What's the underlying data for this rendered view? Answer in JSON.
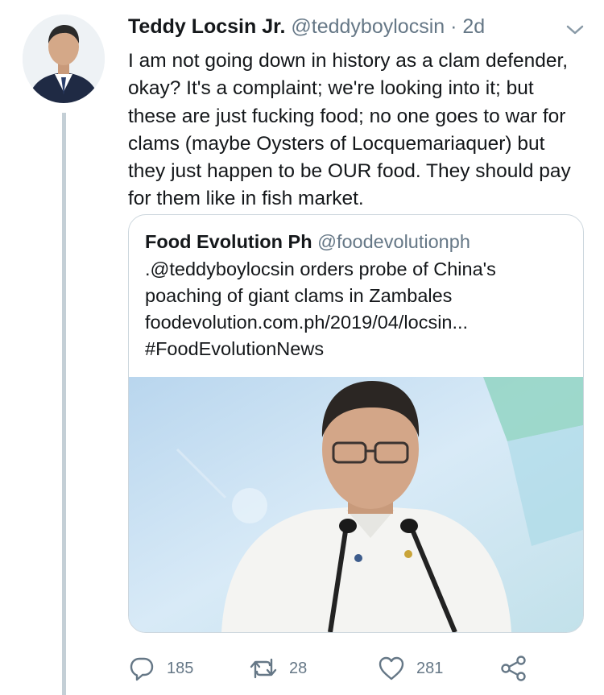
{
  "tweet": {
    "author_name": "Teddy Locsin Jr.",
    "handle": "@teddyboylocsin",
    "separator": "·",
    "time": "2d",
    "text": "I am not going down in history as a clam defender,\nokay? It's a complaint; we're looking into it; but\nthese are just fucking food; no one goes to war for\nclams (maybe Oysters of Locquemariaquer) but\nthey just happen to be OUR food. They should pay\nfor them like in fish market."
  },
  "quoted_tweet": {
    "author_name": "Food Evolution Ph",
    "handle": "@foodevolutionph",
    "text": ".@teddyboylocsin orders probe of China's\npoaching of giant clams in Zambales\nfoodevolution.com.ph/2019/04/locsin...\n#FoodEvolutionNews"
  },
  "actions": {
    "reply_count": "185",
    "retweet_count": "28",
    "like_count": "281"
  },
  "icons": {
    "reply": "reply-icon",
    "retweet": "retweet-icon",
    "like": "heart-icon",
    "share": "share-icon",
    "menu": "chevron-down-icon"
  },
  "colors": {
    "text_primary": "#14171a",
    "text_secondary": "#657786",
    "border": "#ccd6dd",
    "thread_line": "#c4cfd6"
  }
}
